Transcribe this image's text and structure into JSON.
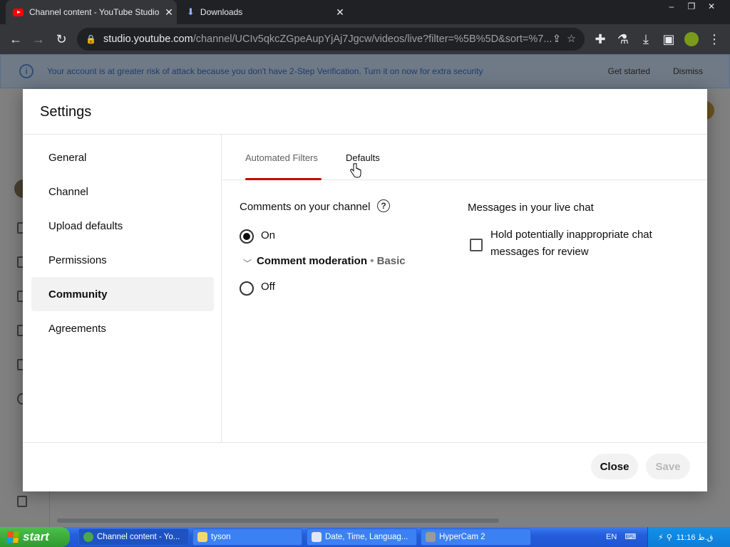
{
  "browser": {
    "tabs": [
      {
        "title": "Channel content - YouTube Studio",
        "active": true
      },
      {
        "title": "Downloads",
        "active": false
      }
    ],
    "window_controls": [
      "–",
      "❐",
      "✕"
    ],
    "url_host": "studio.youtube.com",
    "url_rest": "/channel/UCIv5qkcZGpeAupYjAj7Jgcw/videos/live?filter=%5B%5D&sort=%7..."
  },
  "banner": {
    "message": "Your account is at greater risk of attack because you don't have 2-Step Verification. Turn it on now for extra security",
    "get_started": "Get started",
    "dismiss": "Dismiss"
  },
  "dialog": {
    "title": "Settings",
    "nav": [
      {
        "label": "General",
        "selected": false
      },
      {
        "label": "Channel",
        "selected": false
      },
      {
        "label": "Upload defaults",
        "selected": false
      },
      {
        "label": "Permissions",
        "selected": false
      },
      {
        "label": "Community",
        "selected": true
      },
      {
        "label": "Agreements",
        "selected": false
      }
    ],
    "tabs": [
      {
        "label": "Automated Filters",
        "active": true
      },
      {
        "label": "Defaults",
        "active": false
      }
    ],
    "comments": {
      "title": "Comments on your channel",
      "help": "?",
      "on_label": "On",
      "moderation_label": "Comment moderation",
      "moderation_sep": "•",
      "moderation_level": "Basic",
      "off_label": "Off",
      "selected": "On"
    },
    "live_chat": {
      "title": "Messages in your live chat",
      "hold_label": "Hold potentially inappropriate chat messages for review",
      "hold_checked": false
    },
    "buttons": {
      "close": "Close",
      "save": "Save"
    }
  },
  "taskbar": {
    "start": "start",
    "tasks": [
      {
        "label": "Channel content - Yo...",
        "active": true
      },
      {
        "label": "tyson",
        "active": false
      },
      {
        "label": "Date, Time, Languag...",
        "active": false
      },
      {
        "label": "HyperCam 2",
        "active": false
      }
    ],
    "language": "EN",
    "clock": "11:16 ق.ظ"
  },
  "colors": {
    "accent_underline": "#cc0000",
    "taskbar_blue": "#245edc",
    "start_green": "#2f9a2f"
  }
}
